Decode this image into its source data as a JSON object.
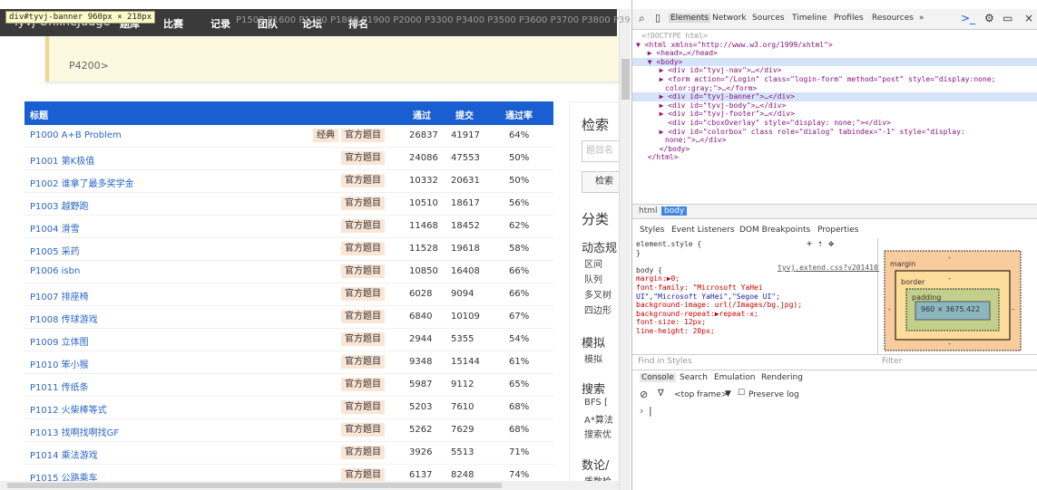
{
  "page": {
    "inspect_tooltip": "div#tyvj-banner 960px × 218px",
    "brand": "Tyvj OnlineJudge",
    "nav": [
      "题库",
      "比赛",
      "记录",
      "团队",
      "论坛",
      "排名"
    ],
    "breadcrumb_bg": "P1500 P1600 P1700 P1800 P1900 P2000 P3300 P3400 P3500 P3600 P3700 P3800 P39",
    "banner_link": "P4200>",
    "table_headers": [
      "标题",
      "通过",
      "提交",
      "通过率"
    ],
    "rows": [
      {
        "title": "P1000 A+B Problem",
        "tags": [
          "经典",
          "官方题目"
        ],
        "pass": "26837",
        "submit": "41917",
        "rate": "64%"
      },
      {
        "title": "P1001 第K极值",
        "tags": [
          "官方题目"
        ],
        "pass": "24086",
        "submit": "47553",
        "rate": "50%"
      },
      {
        "title": "P1002 谁拿了最多奖学金",
        "tags": [
          "官方题目"
        ],
        "pass": "10332",
        "submit": "20631",
        "rate": "50%"
      },
      {
        "title": "P1003 越野跑",
        "tags": [
          "官方题目"
        ],
        "pass": "10510",
        "submit": "18617",
        "rate": "56%"
      },
      {
        "title": "P1004 滑雪",
        "tags": [
          "官方题目"
        ],
        "pass": "11468",
        "submit": "18452",
        "rate": "62%"
      },
      {
        "title": "P1005 采药",
        "tags": [
          "官方题目"
        ],
        "pass": "11528",
        "submit": "19618",
        "rate": "58%"
      },
      {
        "title": "P1006 isbn",
        "tags": [
          "官方题目"
        ],
        "pass": "10850",
        "submit": "16408",
        "rate": "66%"
      },
      {
        "title": "P1007 排座椅",
        "tags": [
          "官方题目"
        ],
        "pass": "6028",
        "submit": "9094",
        "rate": "66%"
      },
      {
        "title": "P1008 传球游戏",
        "tags": [
          "官方题目"
        ],
        "pass": "6840",
        "submit": "10109",
        "rate": "67%"
      },
      {
        "title": "P1009 立体图",
        "tags": [
          "官方题目"
        ],
        "pass": "2944",
        "submit": "5355",
        "rate": "54%"
      },
      {
        "title": "P1010 笨小猴",
        "tags": [
          "官方题目"
        ],
        "pass": "9348",
        "submit": "15144",
        "rate": "61%"
      },
      {
        "title": "P1011 传纸条",
        "tags": [
          "官方题目"
        ],
        "pass": "5987",
        "submit": "9112",
        "rate": "65%"
      },
      {
        "title": "P1012 火柴棒等式",
        "tags": [
          "官方题目"
        ],
        "pass": "5203",
        "submit": "7610",
        "rate": "68%"
      },
      {
        "title": "P1013 找啊找啊找GF",
        "tags": [
          "官方题目"
        ],
        "pass": "5262",
        "submit": "7629",
        "rate": "68%"
      },
      {
        "title": "P1014 乘法游戏",
        "tags": [
          "官方题目"
        ],
        "pass": "3926",
        "submit": "5513",
        "rate": "71%"
      },
      {
        "title": "P1015 公路乘车",
        "tags": [
          "官方题目"
        ],
        "pass": "6137",
        "submit": "8248",
        "rate": "74%"
      }
    ],
    "sidebar": {
      "search_title": "检索",
      "search_placeholder": "题目名",
      "search_button": "检索",
      "category_title": "分类",
      "groups": [
        {
          "title": "动态规",
          "items": [
            "区间",
            "队列",
            "多叉树",
            "四边形"
          ]
        },
        {
          "title": "模拟",
          "items": [
            "模拟"
          ]
        },
        {
          "title": "搜索",
          "items": [
            "BFS  [",
            "A*算法",
            "搜索优"
          ]
        },
        {
          "title": "数论/",
          "items": [
            "质数检"
          ]
        }
      ]
    }
  },
  "devtools": {
    "tabs": [
      "Elements",
      "Network",
      "Sources",
      "Timeline",
      "Profiles",
      "Resources",
      "»"
    ],
    "dom_lines": [
      {
        "indent": 4,
        "text": "<!DOCTYPE html>",
        "style": "gray"
      },
      {
        "indent": 0,
        "text": "▼ <html xmlns=\"http://www.w3.org/1999/xhtml\">",
        "style": ""
      },
      {
        "indent": 8,
        "text": "▶ <head>…</head>",
        "style": ""
      },
      {
        "indent": 8,
        "text": "▼ <body>",
        "style": "sel"
      },
      {
        "indent": 16,
        "text": "▶ <div id=\"tyvj-nav\">…</div>",
        "style": ""
      },
      {
        "indent": 16,
        "text": "▶ <form action=\"/Login\" class=\"login-form\" method=\"post\" style=\"display:none;",
        "style": ""
      },
      {
        "indent": 20,
        "text": "color:gray;\">…</form>",
        "style": ""
      },
      {
        "indent": 16,
        "text": "▶ <div id=\"tyvj-banner\">…</div>",
        "style": "sel"
      },
      {
        "indent": 16,
        "text": "▶ <div id=\"tyvj-body\">…</div>",
        "style": ""
      },
      {
        "indent": 16,
        "text": "▶ <div id=\"tyvj-footer\">…</div>",
        "style": ""
      },
      {
        "indent": 22,
        "text": "<div id=\"cboxOverlay\" style=\"display: none;\"></div>",
        "style": ""
      },
      {
        "indent": 16,
        "text": "▶ <div id=\"colorbox\" class role=\"dialog\" tabindex=\"-1\" style=\"display:",
        "style": ""
      },
      {
        "indent": 20,
        "text": "none;\">…</div>",
        "style": ""
      },
      {
        "indent": 16,
        "text": "</body>",
        "style": ""
      },
      {
        "indent": 8,
        "text": "</html>",
        "style": ""
      }
    ],
    "crumbs": [
      "html",
      "body"
    ],
    "subtabs": [
      "Styles",
      "Event Listeners",
      "DOM Breakpoints",
      "Properties"
    ],
    "styles_lines": [
      {
        "text": "element.style {",
        "color": "#333"
      },
      {
        "text": "}",
        "color": "#333"
      },
      {
        "text": "",
        "color": "#333"
      },
      {
        "text": "body {",
        "color": "#333"
      },
      {
        "text": "  margin:▶0;",
        "color": "#c80000"
      },
      {
        "text": "  font-family: \"Microsoft YaHei",
        "color": "#c80000"
      },
      {
        "text": "     UI\",\"Microsoft YaHei\",\"Segoe UI\";",
        "color": "#1a1aa6"
      },
      {
        "text": "  background-image: url(/Images/bg.jpg);",
        "color": "#c80000"
      },
      {
        "text": "  background-repeat:▶repeat-x;",
        "color": "#c80000"
      },
      {
        "text": "  font-size: 12px;",
        "color": "#c80000"
      },
      {
        "text": "  line-height: 20px;",
        "color": "#c80000"
      }
    ],
    "styles_source": "tyvj.extend.css?v20141013:1",
    "boxmodel": {
      "margin_label": "margin",
      "border_label": "border",
      "padding_label": "padding",
      "content": "960 × 3675.422",
      "dash": "-"
    },
    "find_placeholder": "Find in Styles",
    "filter_placeholder": "Filter",
    "console_tabs": [
      "Console",
      "Search",
      "Emulation",
      "Rendering"
    ],
    "frame_select": "<top frame>",
    "preserve_log": "Preserve log",
    "prompt": "›"
  }
}
